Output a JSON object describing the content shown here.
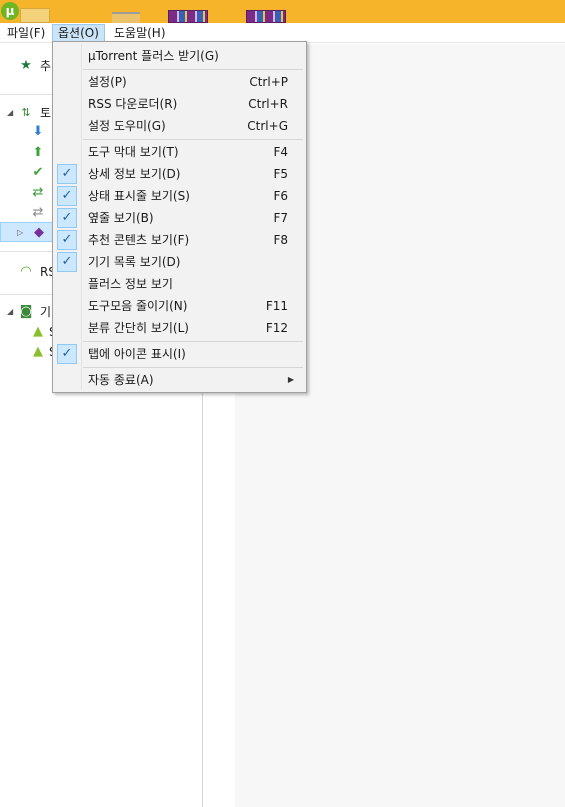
{
  "menubar": {
    "items": [
      {
        "label": "파일(F)"
      },
      {
        "label": "옵션(O)"
      },
      {
        "label": "도움말(H)"
      }
    ]
  },
  "sidebar": {
    "items": [
      {
        "label": "추",
        "icon": "star-icon"
      },
      {
        "label": "토",
        "icon": "torrents-icon"
      },
      {
        "label": "",
        "icon": "download-arrow-icon"
      },
      {
        "label": "",
        "icon": "upload-arrow-icon"
      },
      {
        "label": "",
        "icon": "completed-check-icon"
      },
      {
        "label": "",
        "icon": "active-icon"
      },
      {
        "label": "",
        "icon": "inactive-icon"
      },
      {
        "label": "",
        "icon": "label-tag-icon"
      },
      {
        "label": "RS",
        "icon": "rss-icon"
      },
      {
        "label": "기",
        "icon": "devices-icon"
      },
      {
        "label": "S",
        "icon": "android-icon"
      },
      {
        "label": "S",
        "icon": "android-icon"
      }
    ]
  },
  "options_menu": {
    "items": [
      {
        "label": "µTorrent 플러스 받기(G)",
        "shortcut": "",
        "checked": false
      },
      {
        "label": "설정(P)",
        "shortcut": "Ctrl+P",
        "checked": false
      },
      {
        "label": "RSS 다운로더(R)",
        "shortcut": "Ctrl+R",
        "checked": false
      },
      {
        "label": "설정 도우미(G)",
        "shortcut": "Ctrl+G",
        "checked": false
      },
      {
        "label": "도구 막대 보기(T)",
        "shortcut": "F4",
        "checked": false
      },
      {
        "label": "상세 정보 보기(D)",
        "shortcut": "F5",
        "checked": true
      },
      {
        "label": "상태 표시줄 보기(S)",
        "shortcut": "F6",
        "checked": true
      },
      {
        "label": "옆줄 보기(B)",
        "shortcut": "F7",
        "checked": true
      },
      {
        "label": "추천 콘텐츠 보기(F)",
        "shortcut": "F8",
        "checked": true
      },
      {
        "label": "기기 목록 보기(D)",
        "shortcut": "",
        "checked": true
      },
      {
        "label": "플러스 정보 보기",
        "shortcut": "",
        "checked": false
      },
      {
        "label": "도구모음 줄이기(N)",
        "shortcut": "F11",
        "checked": false
      },
      {
        "label": "분류 간단히 보기(L)",
        "shortcut": "F12",
        "checked": false
      },
      {
        "label": "탭에 아이콘 표시(I)",
        "shortcut": "",
        "checked": true
      },
      {
        "label": "자동 종료(A)",
        "shortcut": "",
        "checked": false,
        "submenu": true
      }
    ],
    "check_glyph": "✓",
    "submenu_glyph": "▶"
  },
  "colors": {
    "titlebar": "#f6b42a",
    "menu_active": "#cce4f7",
    "check_bg": "#cce8ff"
  }
}
